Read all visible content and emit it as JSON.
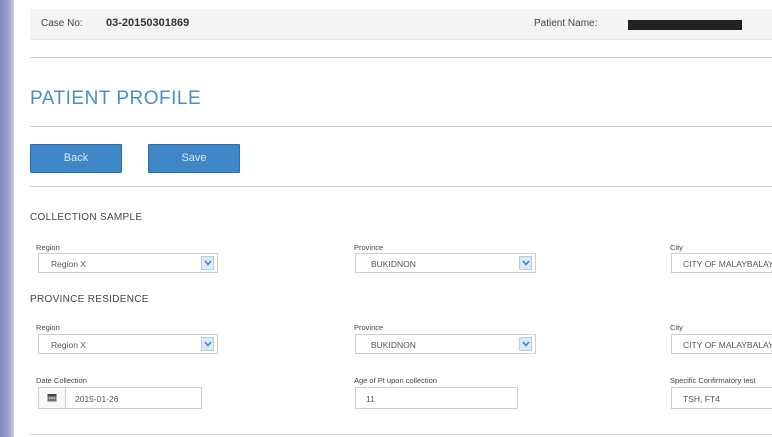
{
  "case_bar": {
    "case_label": "Case No:",
    "case_no": "03-20150301869",
    "patient_label": "Patient Name:"
  },
  "page_title": "PATIENT PROFILE",
  "buttons": {
    "back": "Back",
    "save": "Save"
  },
  "collection_sample": {
    "title": "COLLECTION SAMPLE",
    "region_label": "Region",
    "region_value": "Region X",
    "province_label": "Province",
    "province_value": "BUKIDNON",
    "city_label": "City",
    "city_value": "CITY OF MALAYBALAY"
  },
  "province_residence": {
    "title": "PROVINCE RESIDENCE",
    "region_label": "Region",
    "region_value": "Region X",
    "province_label": "Province",
    "province_value": "BUKIDNON",
    "city_label": "City",
    "city_value": "CITY OF MALAYBALAY"
  },
  "details": {
    "date_label": "Date Collection",
    "date_value": "2015-01-26",
    "age_label": "Age of Pt upon collection",
    "age_value": "11",
    "tests_label": "Specific Confirmatory test",
    "tests_value": "TSH, FT4"
  },
  "icons": {
    "dropdown": "chevron-down-icon",
    "calendar": "calendar-icon"
  },
  "colors": {
    "accent": "#3f86c6",
    "title": "#4a8ec2"
  }
}
